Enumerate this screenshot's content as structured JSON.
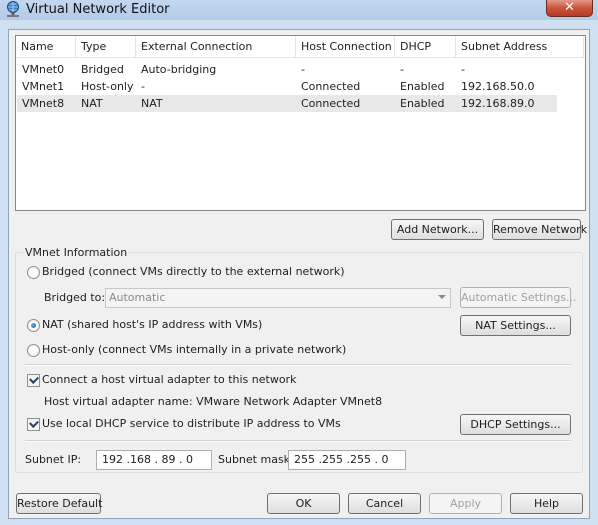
{
  "window": {
    "title": "Virtual Network Editor",
    "close_label": "✕"
  },
  "table": {
    "columns": [
      "Name",
      "Type",
      "External Connection",
      "Host Connection",
      "DHCP",
      "Subnet Address"
    ],
    "rows": [
      [
        "VMnet0",
        "Bridged",
        "Auto-bridging",
        "-",
        "-",
        "-"
      ],
      [
        "VMnet1",
        "Host-only",
        "-",
        "Connected",
        "Enabled",
        "192.168.50.0"
      ],
      [
        "VMnet8",
        "NAT",
        "NAT",
        "Connected",
        "Enabled",
        "192.168.89.0"
      ]
    ],
    "selected_index": 2
  },
  "list_buttons": {
    "add": "Add Network...",
    "remove": "Remove Network"
  },
  "vmnet_info": {
    "legend": "VMnet Information",
    "bridged_label": "Bridged (connect VMs directly to the external network)",
    "bridged_to_label": "Bridged to:",
    "bridged_to_value": "Automatic",
    "auto_settings": "Automatic Settings...",
    "nat_label": "NAT (shared host's IP address with VMs)",
    "nat_settings": "NAT Settings...",
    "hostonly_label": "Host-only (connect VMs internally in a private network)",
    "selected_mode": "nat",
    "connect_adapter_label": "Connect a host virtual adapter to this network",
    "connect_adapter_checked": true,
    "adapter_name_label": "Host virtual adapter name: VMware Network Adapter VMnet8",
    "dhcp_label": "Use local DHCP service to distribute IP address to VMs",
    "dhcp_checked": true,
    "dhcp_settings": "DHCP Settings...",
    "subnet_ip_label": "Subnet IP:",
    "subnet_ip": "192 .168 . 89 .  0",
    "subnet_mask_label": "Subnet mask:",
    "subnet_mask": "255 .255 .255 .  0"
  },
  "footer": {
    "restore": "Restore Default",
    "ok": "OK",
    "cancel": "Cancel",
    "apply": "Apply",
    "help": "Help"
  },
  "colors": {
    "selected_row": "#e8e8e8",
    "titlebar": "#b9d1ea",
    "close_button": "#c9513a"
  }
}
